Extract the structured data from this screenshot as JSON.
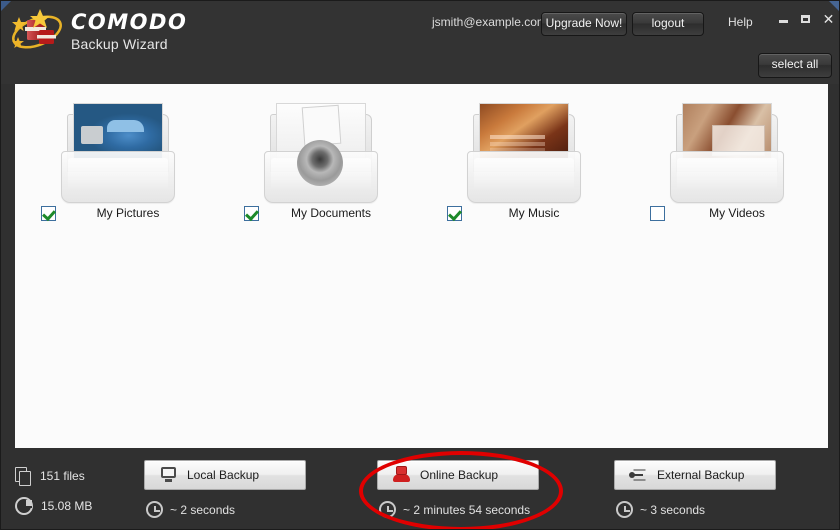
{
  "window": {
    "controls": [
      {
        "name": "minimize",
        "glyph": ""
      },
      {
        "name": "maximize",
        "glyph": ""
      },
      {
        "name": "close",
        "glyph": "✕"
      }
    ]
  },
  "header": {
    "brand_name": "COMODO",
    "brand_sub": "Backup Wizard",
    "logo_icon": "comodo-shield-logo",
    "account_email": "jsmith@example.com",
    "upgrade_label": "Upgrade Now!",
    "logout_label": "logout",
    "help_label": "Help",
    "select_all_label": "select all"
  },
  "main": {
    "folders": [
      {
        "label": "My Pictures",
        "checked": true,
        "thumb": "car-photo-thumbnail",
        "thumb_class": "th-car",
        "icon": "folder-pictures-icon"
      },
      {
        "label": "My Documents",
        "checked": true,
        "thumb": "document-disc-thumbnail",
        "thumb_class": "th-doc",
        "icon": "folder-documents-icon"
      },
      {
        "label": "My Music",
        "checked": true,
        "thumb": "album-art-thumbnail",
        "thumb_class": "th-music",
        "icon": "folder-music-icon"
      },
      {
        "label": "My Videos",
        "checked": false,
        "thumb": "video-frame-thumbnail",
        "thumb_class": "th-video",
        "icon": "folder-videos-icon"
      }
    ]
  },
  "footer": {
    "stats": [
      {
        "icon": "files-icon",
        "text": "151 files"
      },
      {
        "icon": "pie-chart-icon",
        "text": "15.08 MB"
      }
    ],
    "backup_options": [
      {
        "label": "Local Backup",
        "icon": "monitor-icon",
        "eta": "~  2 seconds",
        "highlighted": false
      },
      {
        "label": "Online Backup",
        "icon": "server-icon",
        "eta": "~  2 minutes 54 seconds",
        "highlighted": true
      },
      {
        "label": "External Backup",
        "icon": "usb-icon",
        "eta": "~  3 seconds",
        "highlighted": false
      }
    ],
    "highlight_color": "#e00000"
  }
}
